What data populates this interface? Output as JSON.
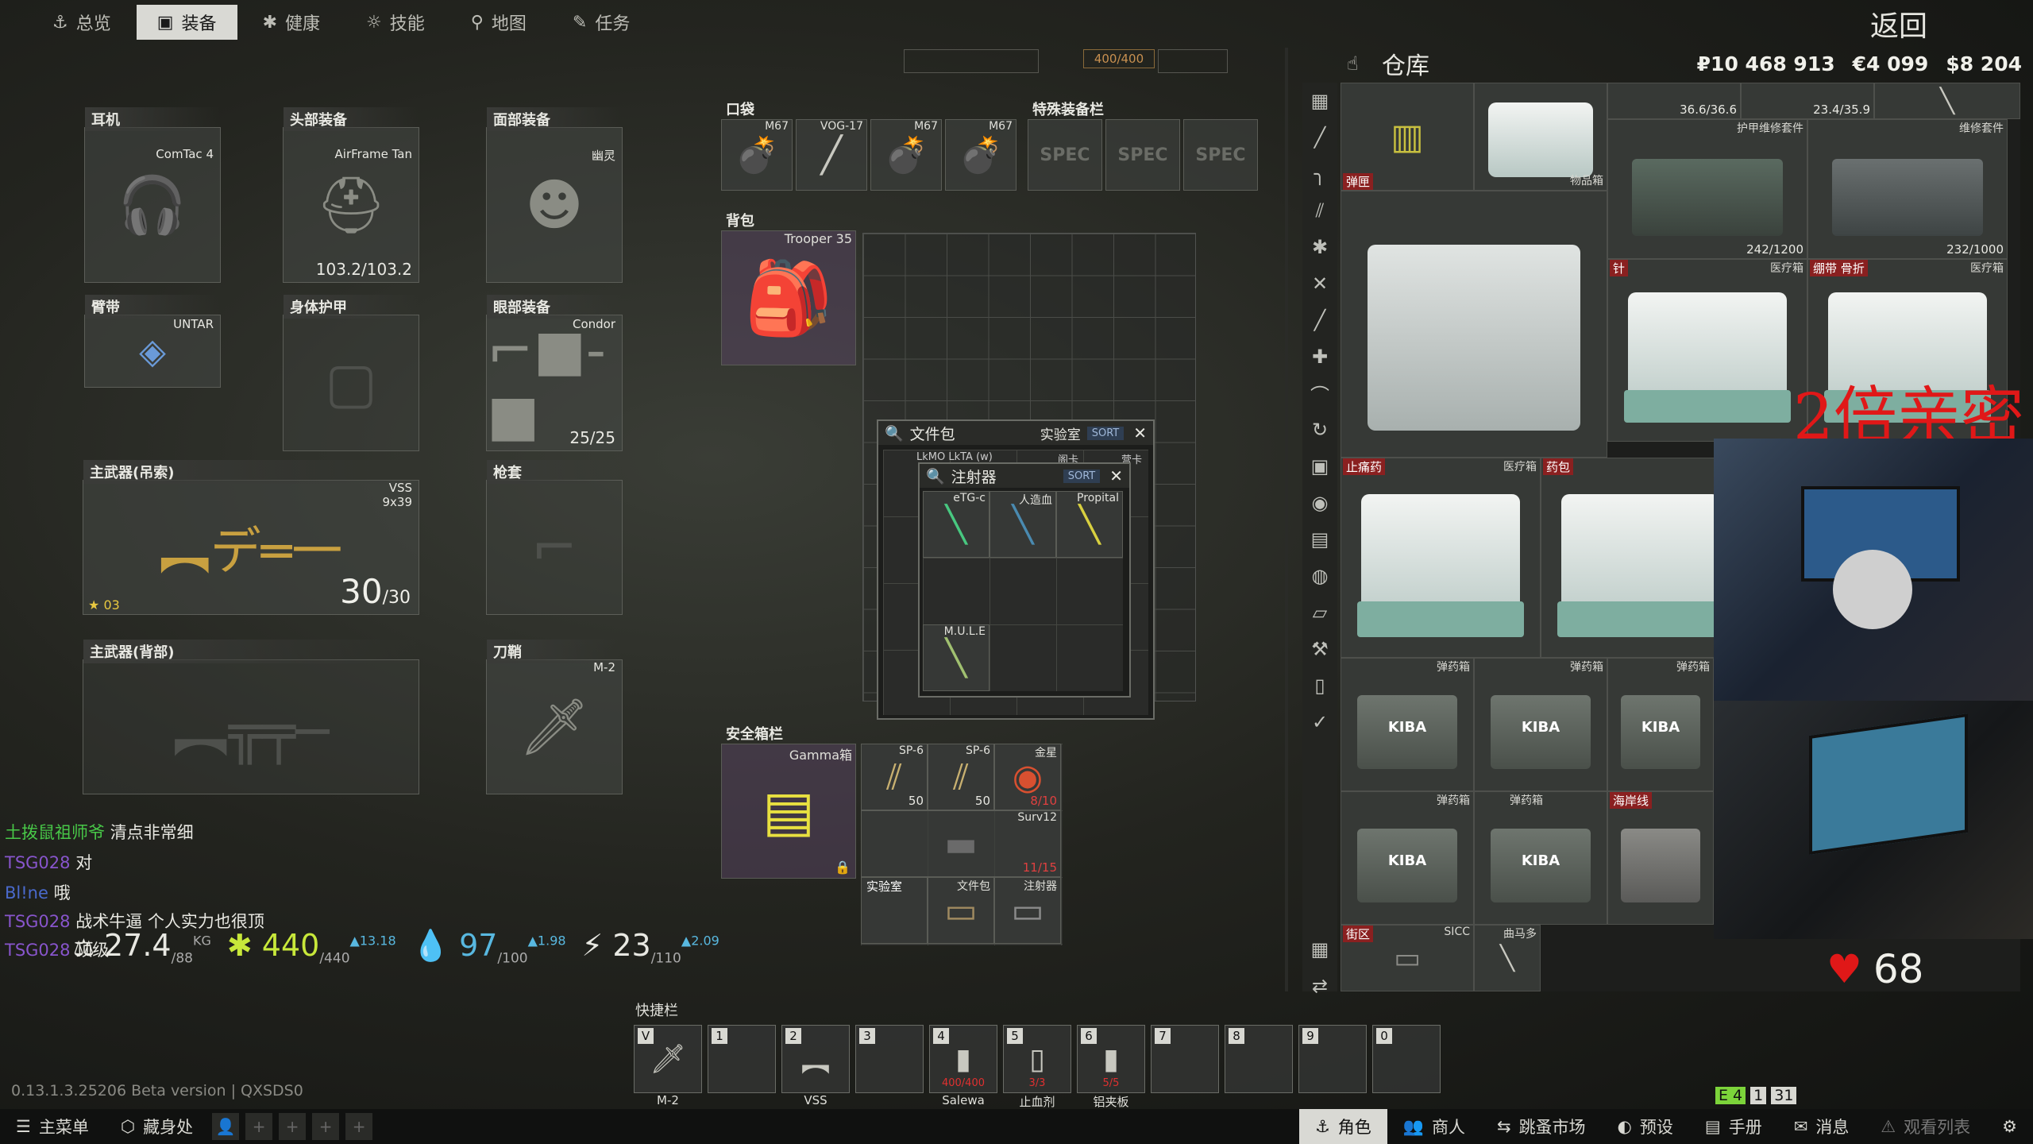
{
  "top_tabs": [
    {
      "label": "总览",
      "icon": "person"
    },
    {
      "label": "装备",
      "icon": "shirt"
    },
    {
      "label": "健康",
      "icon": "health"
    },
    {
      "label": "技能",
      "icon": "skills"
    },
    {
      "label": "地图",
      "icon": "map"
    },
    {
      "label": "任务",
      "icon": "task"
    }
  ],
  "back_label": "返回",
  "hp_badge": "400/400",
  "gear": {
    "earpiece": {
      "title": "耳机",
      "item": "ComTac 4"
    },
    "headwear": {
      "title": "头部装备",
      "item": "AirFrame Tan",
      "durability": "103.2/103.2"
    },
    "face": {
      "title": "面部装备",
      "item": "幽灵"
    },
    "armband": {
      "title": "臂带",
      "item": "UNTAR"
    },
    "armor": {
      "title": "身体护甲"
    },
    "eyewear": {
      "title": "眼部装备",
      "item": "Condor",
      "durability": "25/25"
    },
    "primary1": {
      "title": "主武器(吊索)",
      "item": "VSS",
      "caliber": "9x39",
      "ammo": "30",
      "ammo_max": "/30",
      "level": "03"
    },
    "holster": {
      "title": "枪套"
    },
    "primary2": {
      "title": "主武器(背部)"
    },
    "scabbard": {
      "title": "刀鞘",
      "item": "M-2"
    }
  },
  "pockets": {
    "title": "口袋",
    "items": [
      "M67",
      "VOG-17",
      "M67",
      "M67"
    ]
  },
  "special": {
    "title": "特殊装备栏",
    "items": [
      "SPEC",
      "SPEC",
      "SPEC"
    ]
  },
  "backpack": {
    "title": "背包",
    "item": "Trooper 35"
  },
  "secure": {
    "title": "安全箱栏",
    "item": "Gamma箱",
    "items": [
      {
        "name": "SP-6",
        "count": "50"
      },
      {
        "name": "SP-6",
        "count": "50"
      },
      {
        "name": "金星",
        "count": "8/10"
      },
      {
        "name": "Surv12",
        "count": "11/15"
      },
      {
        "name": "实验室"
      },
      {
        "name": "文件包"
      },
      {
        "name": "注射器"
      }
    ]
  },
  "doc_case": {
    "title": "文件包",
    "subtitle": "实验室",
    "sort": "SORT",
    "row_labels": [
      "LkMO LkTA (w)",
      "阁卡",
      "营卡"
    ]
  },
  "injector_case": {
    "title": "注射器",
    "sort": "SORT",
    "items": [
      "eTG-c",
      "人造血",
      "Propital",
      "M.U.L.E"
    ]
  },
  "stash": {
    "title": "仓库",
    "money": {
      "rub": "₽10 468 913",
      "eur": "€4 099",
      "usd": "$8 204"
    },
    "cells": [
      {
        "tag": "弹匣",
        "name": ""
      },
      {
        "name": "物品箱"
      },
      {
        "name": "",
        "count": "36.6/36.6"
      },
      {
        "name": "",
        "count": "23.4/35.9"
      },
      {
        "name": "护甲维修套件",
        "count": "242/1200"
      },
      {
        "name": "维修套件",
        "count": "232/1000"
      },
      {
        "tag": "针",
        "name": "医疗箱"
      },
      {
        "tag": "绷带 骨折",
        "name": "医疗箱"
      },
      {
        "tag": "止痛药",
        "name": "医疗箱"
      },
      {
        "tag": "药包",
        "name": ""
      },
      {
        "name": "弹药箱"
      },
      {
        "name": "弹药箱"
      },
      {
        "name": "弹药箱"
      },
      {
        "name": "弹药箱"
      },
      {
        "tag": "海岸线",
        "name": "弹药箱"
      },
      {
        "tag": "街区",
        "name": "SICC"
      },
      {
        "name": "曲马多"
      }
    ],
    "kiba": "KIBA"
  },
  "watermark": "2倍亲密",
  "heart_rate": "68",
  "chat": [
    {
      "user": "土拨鼠祖师爷",
      "msg": "清点非常细"
    },
    {
      "user": "TSG028",
      "msg": "对"
    },
    {
      "user": "Bl!ne",
      "msg": "哦"
    },
    {
      "user": "TSG028",
      "msg": "战术牛逼 个人实力也很顶"
    },
    {
      "user": "TSG028",
      "msg": "顶级"
    }
  ],
  "stats": {
    "weight": "27.4",
    "weight_max": "/88",
    "weight_unit": "KG",
    "health": "440",
    "health_max": "/440",
    "health_rate": "13.18",
    "hydration": "97",
    "hydration_max": "/100",
    "hydration_rate": "1.98",
    "energy": "23",
    "energy_max": "/110",
    "energy_rate": "2.09"
  },
  "quickbar": {
    "title": "快捷栏",
    "slots": [
      {
        "key": "V",
        "name": "M-2"
      },
      {
        "key": "1",
        "name": ""
      },
      {
        "key": "2",
        "name": "VSS"
      },
      {
        "key": "3",
        "name": ""
      },
      {
        "key": "4",
        "name": "Salewa",
        "count": "400/400"
      },
      {
        "key": "5",
        "name": "止血剂",
        "count": "3/3"
      },
      {
        "key": "6",
        "name": "铝夹板",
        "count": "5/5"
      },
      {
        "key": "7",
        "name": ""
      },
      {
        "key": "8",
        "name": ""
      },
      {
        "key": "9",
        "name": ""
      },
      {
        "key": "0",
        "name": ""
      }
    ]
  },
  "version": "0.13.1.3.25206 Beta version | QXSDS0",
  "counters": [
    "E 4",
    "1",
    "31"
  ],
  "bottom_bar": {
    "main_menu": "主菜单",
    "hideout": "藏身处",
    "character": "角色",
    "traders": "商人",
    "flea": "跳蚤市场",
    "presets": "预设",
    "handbook": "手册",
    "messages": "消息",
    "watchlist": "观看列表"
  },
  "colors": {
    "accent": "#d9d9d4",
    "health": "#c8e83a",
    "hydration": "#58b8e0",
    "danger": "#e01818"
  }
}
